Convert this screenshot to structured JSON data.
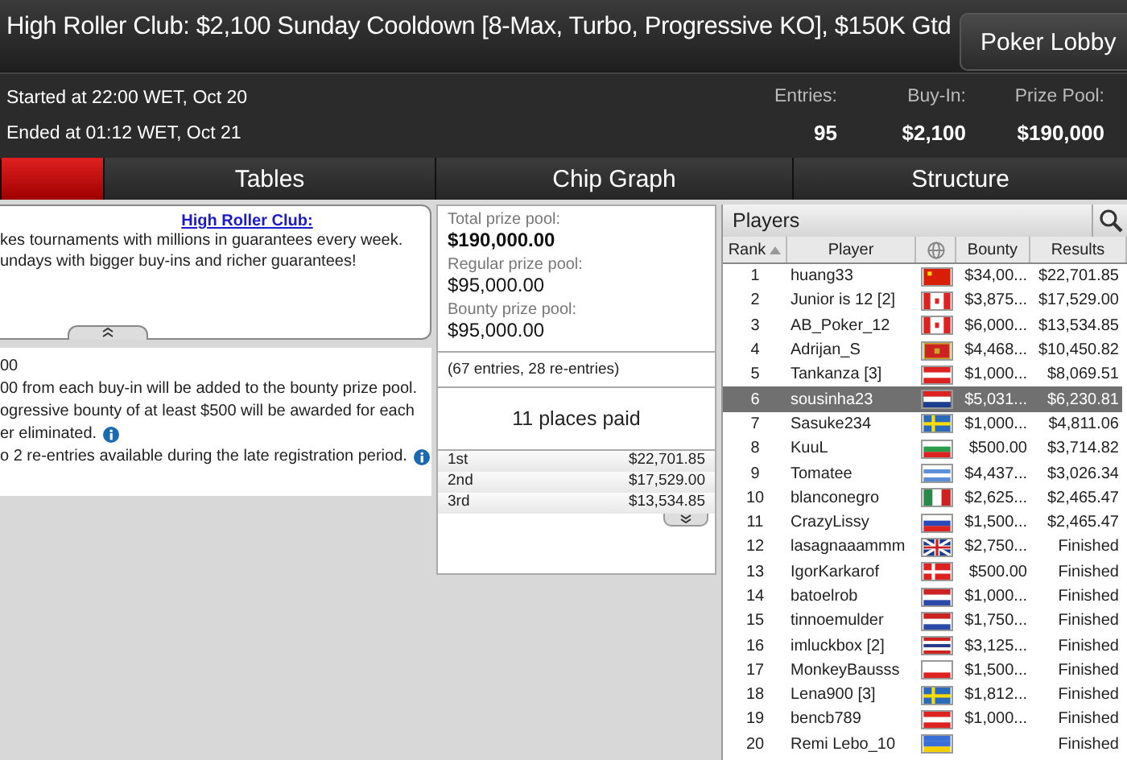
{
  "window": {
    "title": "High Roller Club: $2,100 Sunday Cooldown [8-Max, Turbo, Progressive KO], $150K Gtd",
    "lobby_button": "Poker Lobby"
  },
  "info": {
    "started": "Started at 22:00 WET, Oct 20",
    "ended": "Ended at 01:12 WET, Oct 21",
    "stats": [
      {
        "label": "Entries:",
        "value": "95"
      },
      {
        "label": "Buy-In:",
        "value": "$2,100"
      },
      {
        "label": "Prize Pool:",
        "value": "$190,000"
      }
    ]
  },
  "tabs": [
    {
      "selected": true
    },
    {
      "label": "Tables",
      "selected": false
    },
    {
      "label": "Chip Graph",
      "selected": false
    },
    {
      "label": "Structure",
      "selected": false
    }
  ],
  "description": {
    "link": "High Roller Club:",
    "lines": [
      "kes tournaments with millions in guarantees every week.",
      "undays with bigger buy-ins and richer guarantees!"
    ]
  },
  "details": [
    {
      "text": "00",
      "info": false
    },
    {
      "text": "00 from each buy-in will be added to the bounty prize pool.",
      "info": false
    },
    {
      "text": "ogressive bounty of at least $500 will be awarded for each",
      "info": false
    },
    {
      "text": "er eliminated.",
      "info": true
    },
    {
      "text": "o 2 re-entries available during the late registration period.",
      "info": true
    }
  ],
  "prizes": {
    "pools": [
      {
        "label": "Total prize pool:",
        "value": "$190,000.00"
      },
      {
        "label": "Regular prize pool:",
        "value": "$95,000.00"
      },
      {
        "label": "Bounty prize pool:",
        "value": "$95,000.00"
      }
    ],
    "entries_note": "(67 entries, 28 re-entries)",
    "places_paid": "11 places paid",
    "payouts": [
      {
        "place": "1st",
        "amount": "$22,701.85"
      },
      {
        "place": "2nd",
        "amount": "$17,529.00"
      },
      {
        "place": "3rd",
        "amount": "$13,534.85"
      }
    ]
  },
  "players": {
    "title": "Players",
    "columns": [
      "Rank",
      "Player",
      "Bounty",
      "Results"
    ],
    "rows": [
      {
        "rank": "1",
        "player": "huang33",
        "bounty": "$34,00...",
        "result": "$22,701.85",
        "selected": false
      },
      {
        "rank": "2",
        "player": "Junior is 12 [2]",
        "bounty": "$3,875...",
        "result": "$17,529.00",
        "selected": false
      },
      {
        "rank": "3",
        "player": "AB_Poker_12",
        "bounty": "$6,000...",
        "result": "$13,534.85",
        "selected": false
      },
      {
        "rank": "4",
        "player": "Adrijan_S",
        "bounty": "$4,468...",
        "result": "$10,450.82",
        "selected": false
      },
      {
        "rank": "5",
        "player": "Tankanza [3]",
        "bounty": "$1,000...",
        "result": "$8,069.51",
        "selected": false
      },
      {
        "rank": "6",
        "player": "sousinha23",
        "bounty": "$5,031...",
        "result": "$6,230.81",
        "selected": true
      },
      {
        "rank": "7",
        "player": "Sasuke234",
        "bounty": "$1,000...",
        "result": "$4,811.06",
        "selected": false
      },
      {
        "rank": "8",
        "player": "KuuL",
        "bounty": "$500.00",
        "result": "$3,714.82",
        "selected": false
      },
      {
        "rank": "9",
        "player": "Tomatee",
        "bounty": "$4,437...",
        "result": "$3,026.34",
        "selected": false
      },
      {
        "rank": "10",
        "player": "blanconegro",
        "bounty": "$2,625...",
        "result": "$2,465.47",
        "selected": false
      },
      {
        "rank": "11",
        "player": "CrazyLissy",
        "bounty": "$1,500...",
        "result": "$2,465.47",
        "selected": false
      },
      {
        "rank": "12",
        "player": "lasagnaaammm",
        "bounty": "$2,750...",
        "result": "Finished",
        "selected": false
      },
      {
        "rank": "13",
        "player": "IgorKarkarof",
        "bounty": "$500.00",
        "result": "Finished",
        "selected": false
      },
      {
        "rank": "14",
        "player": "batoelrob",
        "bounty": "$1,000...",
        "result": "Finished",
        "selected": false
      },
      {
        "rank": "15",
        "player": "tinnoemulder",
        "bounty": "$1,750...",
        "result": "Finished",
        "selected": false
      },
      {
        "rank": "16",
        "player": "imluckbox [2]",
        "bounty": "$3,125...",
        "result": "Finished",
        "selected": false
      },
      {
        "rank": "17",
        "player": "MonkeyBausss",
        "bounty": "$1,500...",
        "result": "Finished",
        "selected": false
      },
      {
        "rank": "18",
        "player": "Lena900 [3]",
        "bounty": "$1,812...",
        "result": "Finished",
        "selected": false
      },
      {
        "rank": "19",
        "player": "bencb789",
        "bounty": "$1,000...",
        "result": "Finished",
        "selected": false
      },
      {
        "rank": "20",
        "player": "Remi Lebo_10",
        "result": "Finished",
        "selected": false
      }
    ]
  }
}
